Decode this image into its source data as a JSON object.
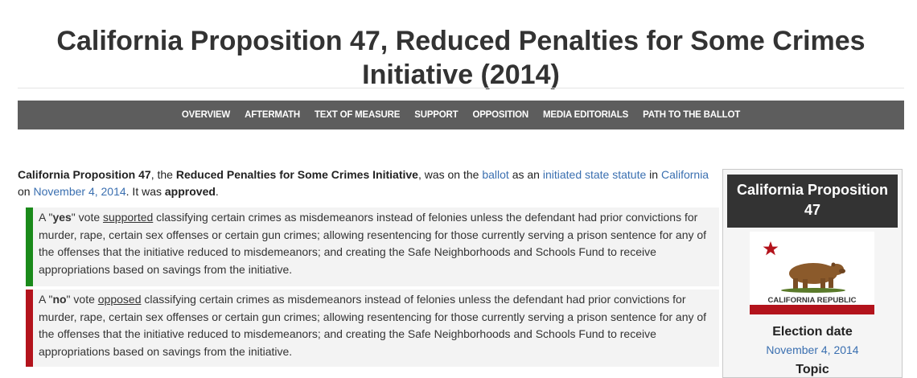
{
  "page": {
    "title": "California Proposition 47, Reduced Penalties for Some Crimes Initiative (2014)"
  },
  "nav": [
    "OVERVIEW",
    "AFTERMATH",
    "TEXT OF MEASURE",
    "SUPPORT",
    "OPPOSITION",
    "MEDIA EDITORIALS",
    "PATH TO THE BALLOT"
  ],
  "intro": {
    "name": "California Proposition 47",
    "t1": ", the ",
    "initiative": "Reduced Penalties for Some Crimes Initiative",
    "t2": ", was on the ",
    "ballot_link": "ballot",
    "t3": " as an ",
    "statute_link": "initiated state statute",
    "t4": " in ",
    "state_link": "California",
    "t5": " on ",
    "date_link": "November 4, 2014",
    "t6": ". It was ",
    "result": "approved",
    "t7": "."
  },
  "vote_yes": {
    "pre": "A \"",
    "word": "yes",
    "mid": "\" vote ",
    "link": "supported",
    "text": " classifying certain crimes as misdemeanors instead of felonies unless the defendant had prior convictions for murder, rape, certain sex offenses or certain gun crimes; allowing resentencing for those currently serving a prison sentence for any of the offenses that the initiative reduced to misdemeanors; and creating the Safe Neighborhoods and Schools Fund to receive appropriations based on savings from the initiative.",
    "color": "#1a8a1a"
  },
  "vote_no": {
    "pre": "A \"",
    "word": "no",
    "mid": "\" vote ",
    "link": "opposed",
    "text": " classifying certain crimes as misdemeanors instead of felonies unless the defendant had prior convictions for murder, rape, certain sex offenses or certain gun crimes; allowing resentencing for those currently serving a prison sentence for any of the offenses that the initiative reduced to misdemeanors; and creating the Safe Neighborhoods and Schools Fund to receive appropriations based on savings from the initiative.",
    "color": "#b3131c"
  },
  "infobox": {
    "title": "California Proposition 47",
    "flag_text": "CALIFORNIA REPUBLIC",
    "election_label": "Election date",
    "election_date": "November 4, 2014",
    "topic_label": "Topic"
  },
  "colors": {
    "link": "#3a6fb0",
    "nav_bg": "#5d5d5d",
    "flag_red": "#b3131c",
    "bear_brown": "#8b5a2b"
  }
}
